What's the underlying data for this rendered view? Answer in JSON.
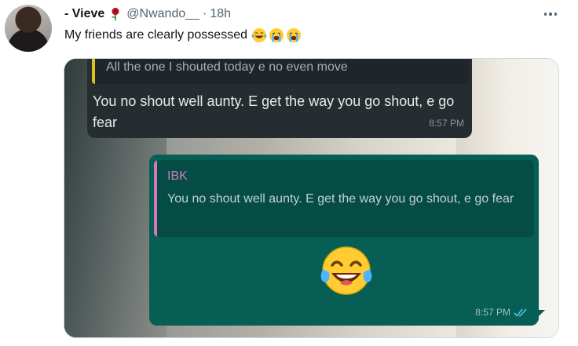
{
  "tweet": {
    "author": {
      "display_name": "- Vieve",
      "name_emoji_icon": "rose-icon",
      "handle": "@Nwando__",
      "separator": "·",
      "time": "18h"
    },
    "more_icon": "more-horizontal-icon",
    "text": "My friends are clearly possessed",
    "text_emojis": [
      "face-with-tears-of-joy-icon",
      "loudly-crying-face-icon",
      "loudly-crying-face-icon"
    ]
  },
  "media": {
    "incoming_message": {
      "quoted_text": "All the one I shouted today e no even move",
      "quote_bar_color": "#d9c21a",
      "text": "You no shout well aunty. E get the way you go shout, e go fear",
      "time": "8:57 PM"
    },
    "outgoing_message": {
      "quoted_author": "IBK",
      "quoted_author_color": "#d776c1",
      "quoted_text": "You no shout well aunty. E get the way you go shout, e go fear",
      "emoji": "face-with-tears-of-joy-icon",
      "time": "8:57 PM",
      "status_icon": "double-tick-read-icon",
      "bubble_color": "#075e54"
    }
  }
}
